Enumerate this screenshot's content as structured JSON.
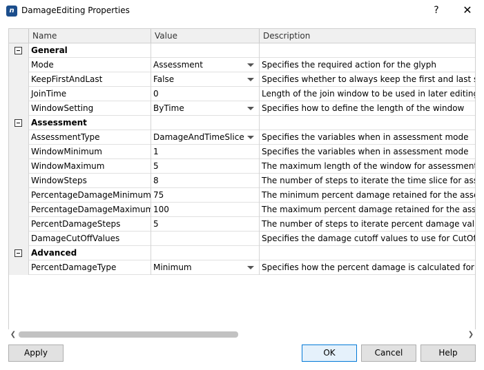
{
  "window": {
    "icon_label": "n",
    "title": "DamageEditing Properties",
    "help_glyph": "?",
    "close_glyph": "✕"
  },
  "grid": {
    "headers": {
      "name": "Name",
      "value": "Value",
      "description": "Description"
    },
    "rows": [
      {
        "kind": "category",
        "name": "General"
      },
      {
        "kind": "property",
        "name": "Mode",
        "value": "Assessment",
        "dropdown": true,
        "description": "Specifies the required action for the glyph"
      },
      {
        "kind": "property",
        "name": "KeepFirstAndLast",
        "value": "False",
        "dropdown": true,
        "description": "Specifies whether to always keep the first and last slice"
      },
      {
        "kind": "property",
        "name": "JoinTime",
        "value": "0",
        "dropdown": false,
        "description": "Length of the join window to be used in later editing proc"
      },
      {
        "kind": "property",
        "name": "WindowSetting",
        "value": "ByTime",
        "dropdown": true,
        "description": "Specifies how to define the length of the window"
      },
      {
        "kind": "category",
        "name": "Assessment"
      },
      {
        "kind": "property",
        "name": "AssessmentType",
        "value": "DamageAndTimeSlice",
        "dropdown": true,
        "description": "Specifies the variables when in assessment mode"
      },
      {
        "kind": "property",
        "name": "WindowMinimum",
        "value": "1",
        "dropdown": false,
        "description": "Specifies the variables when in assessment mode"
      },
      {
        "kind": "property",
        "name": "WindowMaximum",
        "value": "5",
        "dropdown": false,
        "description": "The maximum length of the window for assessment"
      },
      {
        "kind": "property",
        "name": "WindowSteps",
        "value": "8",
        "dropdown": false,
        "description": "The number of steps to iterate the time slice for assessm"
      },
      {
        "kind": "property",
        "name": "PercentageDamageMinimum",
        "value": "75",
        "dropdown": false,
        "description": "The minimum percent damage retained for the assessm"
      },
      {
        "kind": "property",
        "name": "PercentageDamageMaximum",
        "value": "100",
        "dropdown": false,
        "description": "The maximum percent damage retained for the assessm"
      },
      {
        "kind": "property",
        "name": "PercentDamageSteps",
        "value": "5",
        "dropdown": false,
        "description": "The number of steps to iterate percent damage value fo"
      },
      {
        "kind": "property",
        "name": "DamageCutOffValues",
        "value": "",
        "dropdown": false,
        "description": "Specifies the damage cutoff values to use for CutOffAnd"
      },
      {
        "kind": "category",
        "name": "Advanced"
      },
      {
        "kind": "property",
        "name": "PercentDamageType",
        "value": "Minimum",
        "dropdown": true,
        "description": "Specifies how the percent damage is calculated for mult"
      }
    ]
  },
  "scrollbar": {
    "left_arrow": "❮",
    "right_arrow": "❯",
    "thumb_fraction": 0.49
  },
  "buttons": {
    "apply": "Apply",
    "ok": "OK",
    "cancel": "Cancel",
    "help": "Help"
  }
}
